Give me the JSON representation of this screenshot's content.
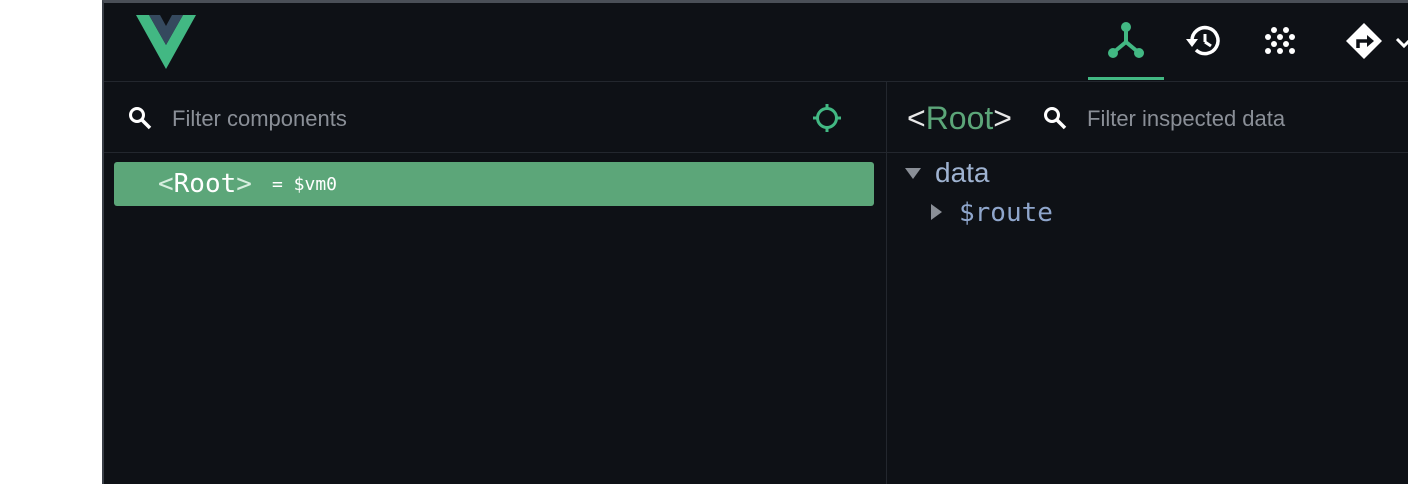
{
  "toolbar": {
    "logo": "vue-logo",
    "tabs": [
      {
        "name": "components",
        "icon": "component-tree-icon",
        "active": true
      },
      {
        "name": "history",
        "icon": "history-icon",
        "active": false
      },
      {
        "name": "events",
        "icon": "dots-grid-icon",
        "active": false
      },
      {
        "name": "routing",
        "icon": "directions-icon",
        "active": false
      }
    ],
    "accent_color": "#42b883"
  },
  "components_pane": {
    "filter_placeholder": "Filter components",
    "tree": [
      {
        "open": "<",
        "name": "Root",
        "close": ">",
        "ref": "= $vm0",
        "selected": true
      }
    ]
  },
  "inspector_pane": {
    "title_open": "<",
    "title_name": "Root",
    "title_close": ">",
    "filter_placeholder": "Filter inspected data",
    "sections": [
      {
        "label": "data",
        "expanded": true,
        "children": [
          {
            "key": "$route",
            "expanded": false
          }
        ]
      }
    ]
  }
}
